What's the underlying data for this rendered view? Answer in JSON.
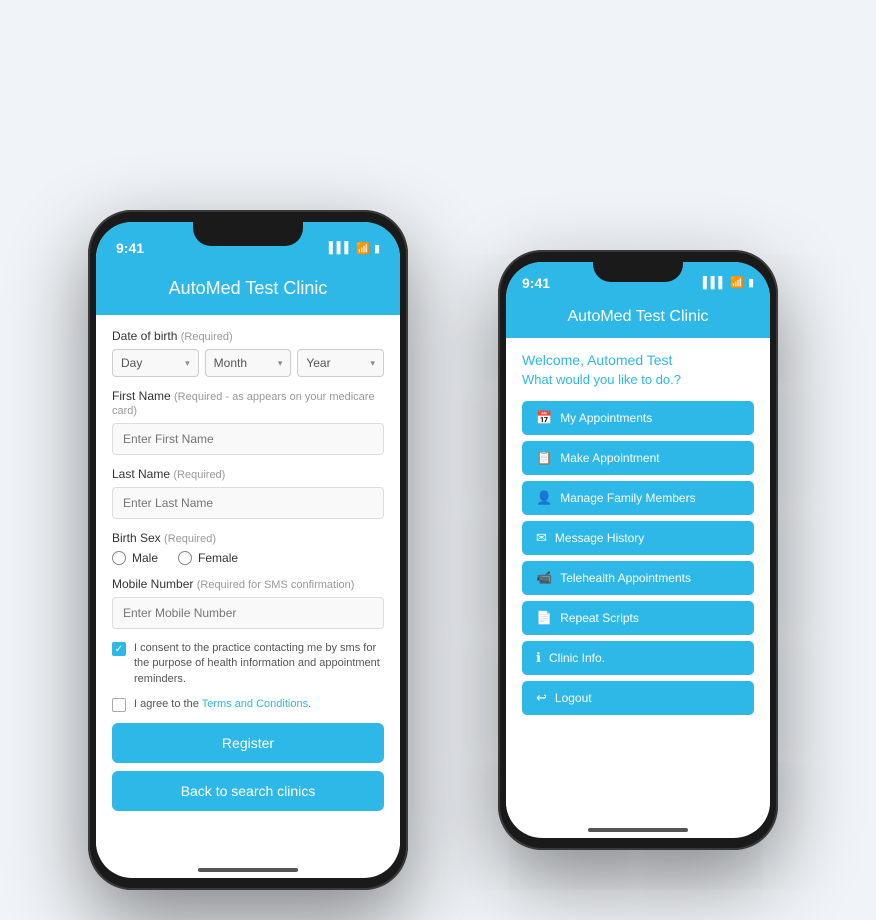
{
  "phone1": {
    "status_time": "9:41",
    "signal": "▌▌▌",
    "wifi": "wifi",
    "battery": "battery",
    "header_title": "AutoMed Test Clinic",
    "form": {
      "dob_label": "Date of birth",
      "dob_required": "(Required)",
      "day_placeholder": "Day",
      "month_placeholder": "Month",
      "year_placeholder": "Year",
      "first_name_label": "First Name",
      "first_name_required": "(Required - as appears on your medicare card)",
      "first_name_placeholder": "Enter First Name",
      "last_name_label": "Last Name",
      "last_name_required": "(Required)",
      "last_name_placeholder": "Enter Last Name",
      "birth_sex_label": "Birth Sex",
      "birth_sex_required": "(Required)",
      "male_label": "Male",
      "female_label": "Female",
      "mobile_label": "Mobile Number",
      "mobile_required": "(Required for SMS confirmation)",
      "mobile_placeholder": "Enter Mobile Number",
      "consent_text": "I consent to the practice contacting me by sms for the purpose of health information and appointment reminders.",
      "terms_prefix": "I agree to the ",
      "terms_link": "Terms and Conditions",
      "terms_suffix": ".",
      "register_btn": "Register",
      "back_btn": "Back to search clinics"
    }
  },
  "phone2": {
    "status_time": "9:41",
    "header_title": "AutoMed Test Clinic",
    "welcome_text": "Welcome, Automed Test",
    "question_text": "What would you like to do.?",
    "menu_items": [
      {
        "icon": "📅",
        "label": "My Appointments"
      },
      {
        "icon": "📋",
        "label": "Make Appointment"
      },
      {
        "icon": "👤",
        "label": "Manage Family Members"
      },
      {
        "icon": "✉",
        "label": "Message History"
      },
      {
        "icon": "📹",
        "label": "Telehealth Appointments"
      },
      {
        "icon": "📄",
        "label": "Repeat Scripts"
      },
      {
        "icon": "ℹ",
        "label": "Clinic Info."
      },
      {
        "icon": "↩",
        "label": "Logout"
      }
    ]
  }
}
